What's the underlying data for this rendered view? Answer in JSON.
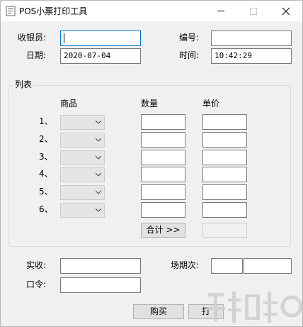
{
  "window": {
    "title": "POS小票打印工具",
    "accent_color": "#0078d7"
  },
  "fields": {
    "cashier_label": "收银员:",
    "cashier_value": "",
    "number_label": "编号:",
    "number_value": "",
    "date_label": "日期:",
    "date_value": "2020-07-04",
    "time_label": "时间:",
    "time_value": "10:42:29"
  },
  "list": {
    "group_title": "列表",
    "col_product": "商品",
    "col_quantity": "数量",
    "col_price": "单价",
    "rows": [
      {
        "index": "1、",
        "product": "",
        "quantity": "",
        "price": ""
      },
      {
        "index": "2、",
        "product": "",
        "quantity": "",
        "price": ""
      },
      {
        "index": "3、",
        "product": "",
        "quantity": "",
        "price": ""
      },
      {
        "index": "4、",
        "product": "",
        "quantity": "",
        "price": ""
      },
      {
        "index": "5、",
        "product": "",
        "quantity": "",
        "price": ""
      },
      {
        "index": "6、",
        "product": "",
        "quantity": "",
        "price": ""
      }
    ],
    "total_button": "合计 >>",
    "total_value": ""
  },
  "footer": {
    "received_label": "实收:",
    "received_value": "",
    "session_label": "场期次:",
    "session_value_1": "",
    "session_value_2": "",
    "password_label": "口令:",
    "password_value": "",
    "buy_button": "购买",
    "second_button": "打"
  }
}
